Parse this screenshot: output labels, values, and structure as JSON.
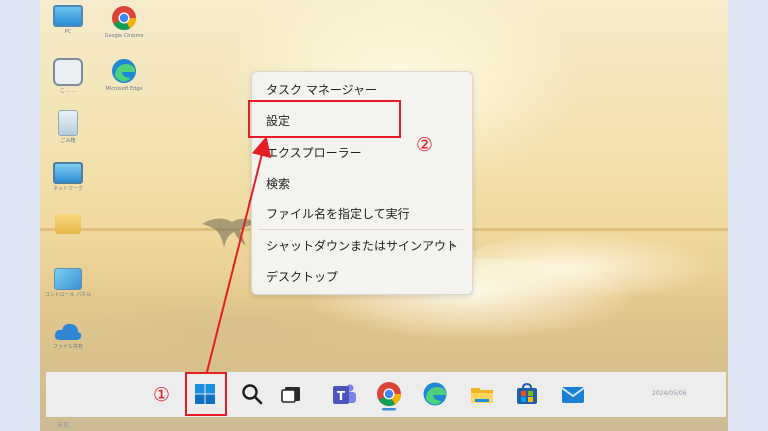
{
  "desktop_icons": [
    {
      "name": "pc",
      "label": "PC"
    },
    {
      "name": "chrome",
      "label": "Google Chrome"
    },
    {
      "name": "help",
      "label": "こ... ..."
    },
    {
      "name": "edge",
      "label": "Microsoft Edge"
    },
    {
      "name": "recycle",
      "label": "ごみ箱"
    },
    {
      "name": "network",
      "label": "ネットワーク"
    },
    {
      "name": "folder",
      "label": ""
    },
    {
      "name": "control-panel",
      "label": "コントロール パネル"
    },
    {
      "name": "onedrive",
      "label": "ファイル共有"
    }
  ],
  "context_menu": {
    "items": [
      {
        "label": "タスク マネージャー"
      },
      {
        "label": "設定"
      },
      {
        "label": "エクスプローラー"
      },
      {
        "label": "検索"
      },
      {
        "label": "ファイル名を指定して実行"
      },
      {
        "label": "シャットダウンまたはサインアウト"
      },
      {
        "label": "デスクトップ"
      }
    ],
    "submenu_arrow": "›"
  },
  "annotations": {
    "step1": "①",
    "step2": "②",
    "highlight_color": "#e51e25"
  },
  "taskbar": {
    "apps": [
      "start",
      "search",
      "task-view",
      "teams",
      "chrome",
      "edge",
      "explorer",
      "store",
      "mail"
    ],
    "left_hint": "天気",
    "date_hint": "2024/05/06"
  },
  "colors": {
    "windows_blue": "#0078d4",
    "menu_bg": "#f4f3ef"
  }
}
